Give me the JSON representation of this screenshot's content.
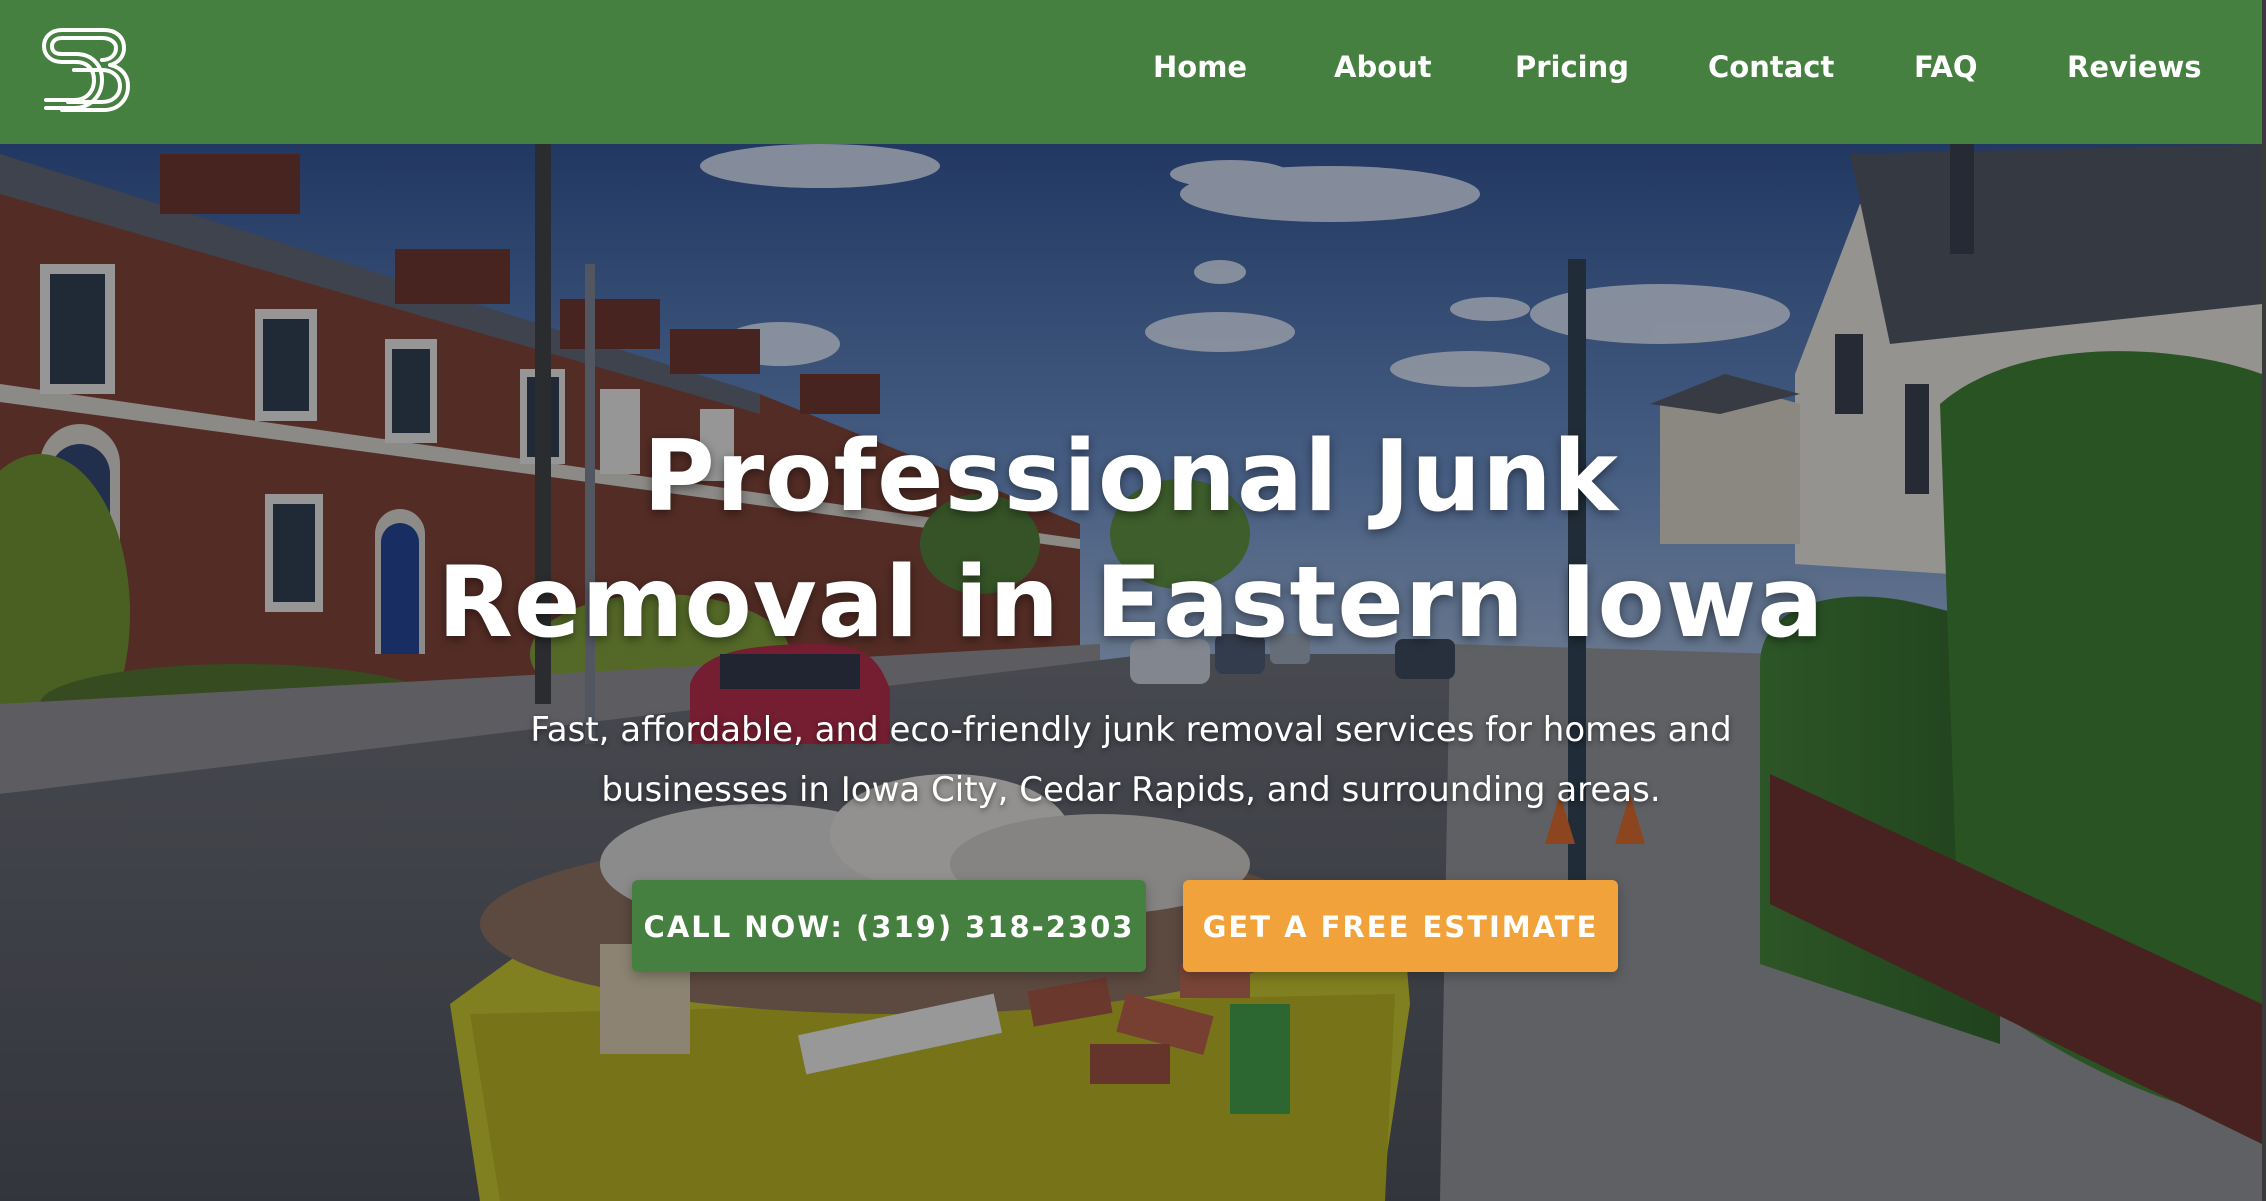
{
  "brand": {
    "logo_icon": "sb-monogram-logo",
    "header_color": "#468041",
    "accent_color": "#f2a23a"
  },
  "nav": {
    "items": [
      {
        "label": "Home"
      },
      {
        "label": "About"
      },
      {
        "label": "Pricing"
      },
      {
        "label": "Contact"
      },
      {
        "label": "FAQ"
      },
      {
        "label": "Reviews"
      }
    ]
  },
  "hero": {
    "title_line1": "Professional Junk",
    "title_line2": "Removal in Eastern Iowa",
    "subtitle_line1": "Fast, affordable, and eco-friendly junk removal services for homes and",
    "subtitle_line2": "businesses in Iowa City, Cedar Rapids, and surrounding areas.",
    "call_button": "CALL NOW: (319) 318-2303",
    "estimate_button": "GET A FREE ESTIMATE"
  }
}
